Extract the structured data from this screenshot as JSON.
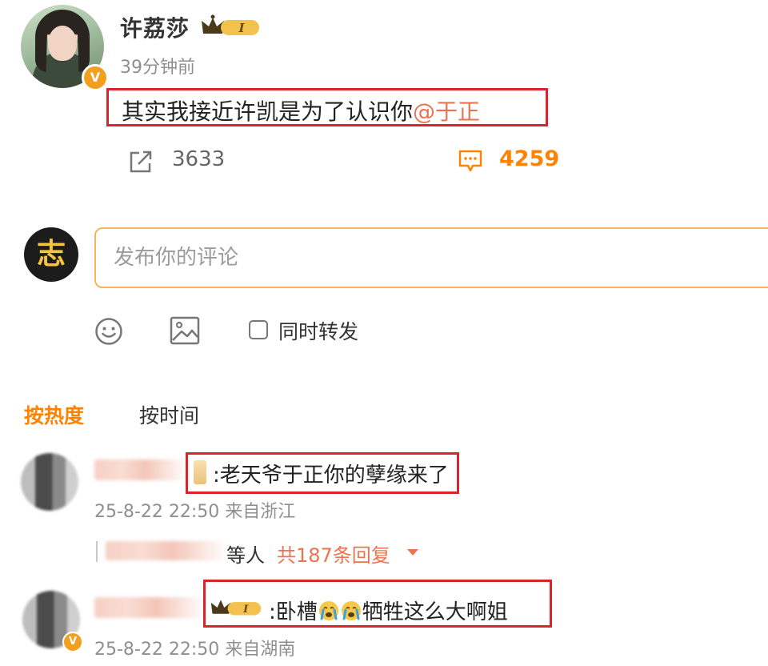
{
  "post": {
    "author": "许荔莎",
    "verified_badge": "V",
    "member_badge_text": "I",
    "time": "39分钟前",
    "text": "其实我接近许凯是为了认识你",
    "mention": "@于正",
    "repost_count": "3633",
    "comment_count": "4259"
  },
  "composer": {
    "avatar_text": "志",
    "placeholder": "发布你的评论",
    "repost_checkbox_label": "同时转发"
  },
  "sort_tabs": {
    "hot": "按热度",
    "time": "按时间"
  },
  "comments": [
    {
      "text": ":老天爷于正你的孽缘来了",
      "time": "25-8-22 22:50",
      "location": "来自浙江",
      "replies_prefix": "等人",
      "replies_count": "共187条回复"
    },
    {
      "text_before": ":卧槽",
      "text_after": "牺牲这么大啊姐",
      "member_badge_text": "I",
      "time": "25-8-22 22:50",
      "location": "来自湖南",
      "verified_badge": "V"
    }
  ],
  "colors": {
    "accent": "#ff8200",
    "mention": "#eb7350",
    "highlight_box": "#d9252a",
    "input_border": "#f7b557"
  }
}
